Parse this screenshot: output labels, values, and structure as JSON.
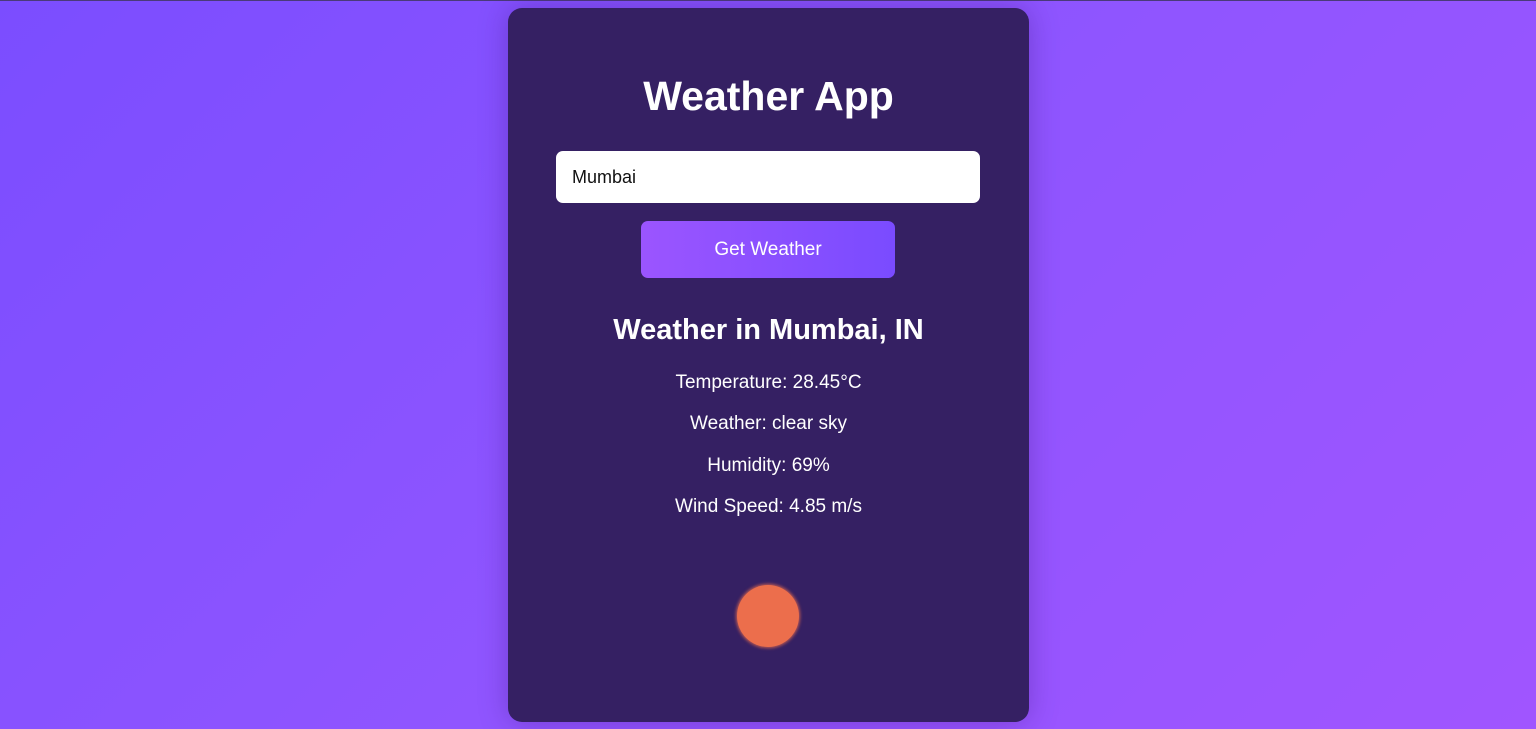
{
  "app": {
    "title": "Weather App"
  },
  "search": {
    "value": "Mumbai",
    "button_label": "Get Weather"
  },
  "result": {
    "heading": "Weather in Mumbai, IN",
    "temperature": "Temperature: 28.45°C",
    "weather": "Weather: clear sky",
    "humidity": "Humidity: 69%",
    "wind": "Wind Speed: 4.85 m/s"
  },
  "icon": {
    "name": "sun-icon",
    "color": "#ec6e4c"
  },
  "colors": {
    "card": "#352063",
    "button_start": "#9b55ff",
    "button_end": "#7a4bff",
    "background_start": "#7b4dff",
    "background_end": "#a055ff"
  }
}
